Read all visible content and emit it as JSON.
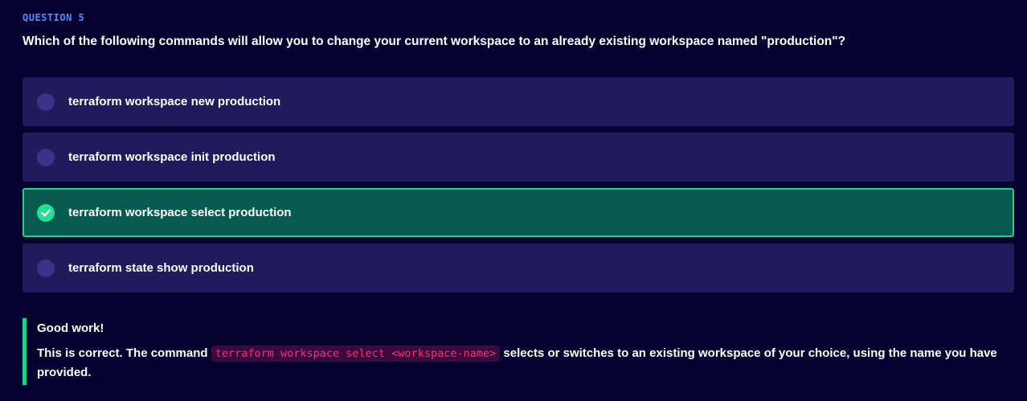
{
  "question": {
    "label": "QUESTION 5",
    "text": "Which of the following commands will allow you to change your current workspace to an already existing workspace named \"production\"?"
  },
  "options": [
    {
      "label": "terraform workspace new production",
      "state": "unselected"
    },
    {
      "label": "terraform workspace init production",
      "state": "unselected"
    },
    {
      "label": "terraform workspace select production",
      "state": "correct"
    },
    {
      "label": "terraform state show production",
      "state": "unselected"
    }
  ],
  "feedback": {
    "title": "Good work!",
    "text_before": "This is correct. The command ",
    "code": "terraform workspace select <workspace-name>",
    "text_after": " selects or switches to an existing workspace of your choice, using the name you have provided."
  },
  "icons": {
    "radio": "radio-unselected-icon",
    "correct": "check-circle-icon"
  },
  "colors": {
    "background": "#05022f",
    "option_bg": "#1f1b5c",
    "correct_bg": "#075a50",
    "correct_accent": "#1fd28a",
    "question_label": "#4f8cff",
    "code_text": "#ff2d6b"
  }
}
